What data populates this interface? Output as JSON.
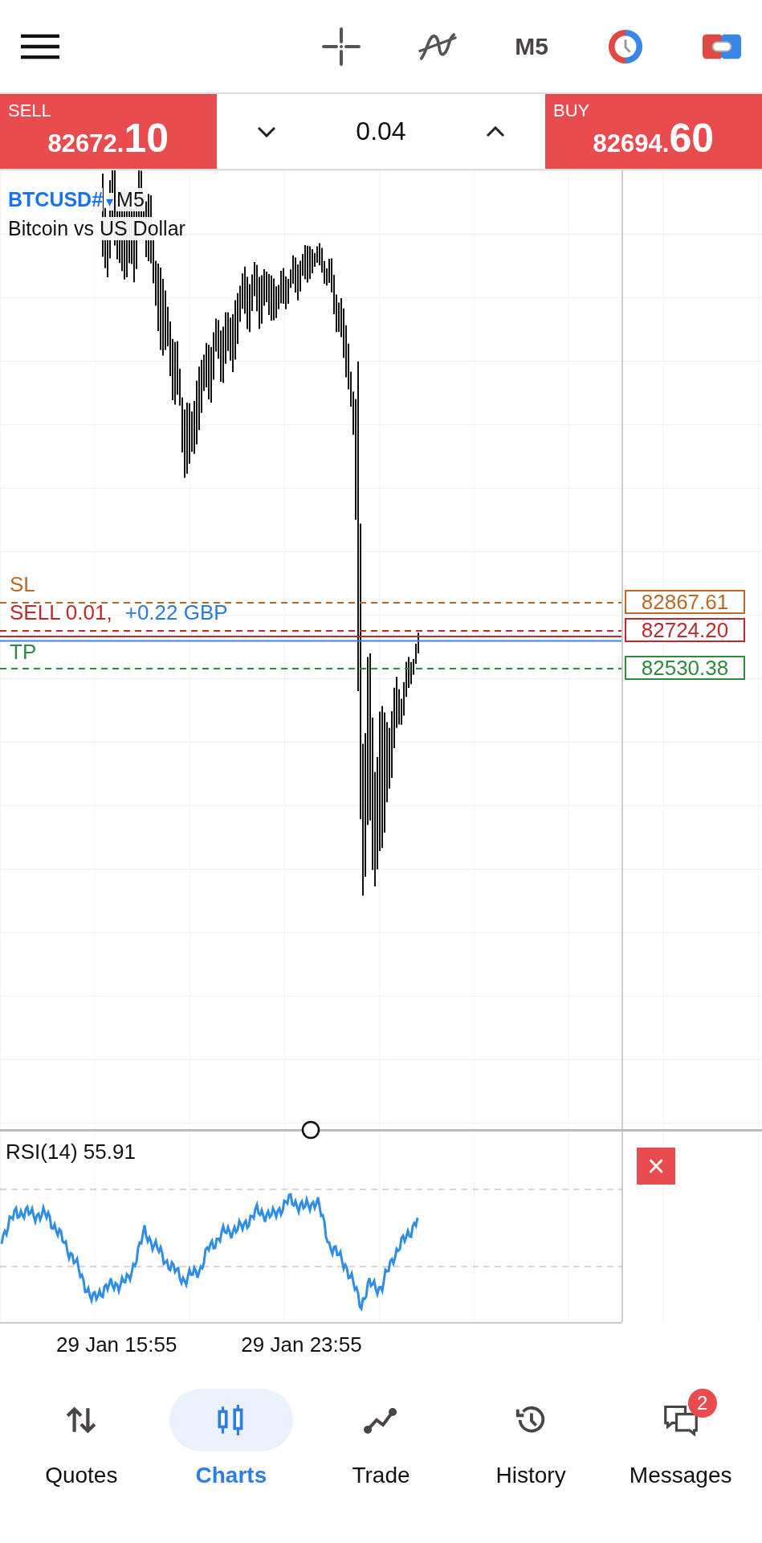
{
  "toolbar": {
    "timeframe": "M5"
  },
  "trade_bar": {
    "sell": {
      "label": "SELL",
      "price_main": "82672.",
      "price_big": "10"
    },
    "volume": "0.04",
    "buy": {
      "label": "BUY",
      "price_main": "82694.",
      "price_big": "60"
    }
  },
  "chart": {
    "symbol": "BTCUSD#",
    "symbol_caret": "▾",
    "timeframe": "M5",
    "description": "Bitcoin vs US Dollar",
    "levels": [
      {
        "kind": "sl",
        "label": "SL",
        "price": "82867.61",
        "color": "#b8692c"
      },
      {
        "kind": "order",
        "label": "SELL 0.01,",
        "profit": "+0.22 GBP",
        "price": "82724.20",
        "color": "#c0282d"
      },
      {
        "kind": "tp",
        "label": "TP",
        "price": "82530.38",
        "color": "#2e8b3e"
      }
    ]
  },
  "indicator": {
    "label": "RSI(14) 55.91",
    "close": "×"
  },
  "time_axis": [
    "29 Jan 15:55",
    "29 Jan 23:55"
  ],
  "nav": [
    {
      "kind": "quotes",
      "label": "Quotes",
      "selected": false
    },
    {
      "kind": "charts",
      "label": "Charts",
      "selected": true
    },
    {
      "kind": "trade",
      "label": "Trade",
      "selected": false
    },
    {
      "kind": "history",
      "label": "History",
      "selected": false
    },
    {
      "kind": "messages",
      "label": "Messages",
      "selected": false,
      "badge": "2"
    }
  ]
}
